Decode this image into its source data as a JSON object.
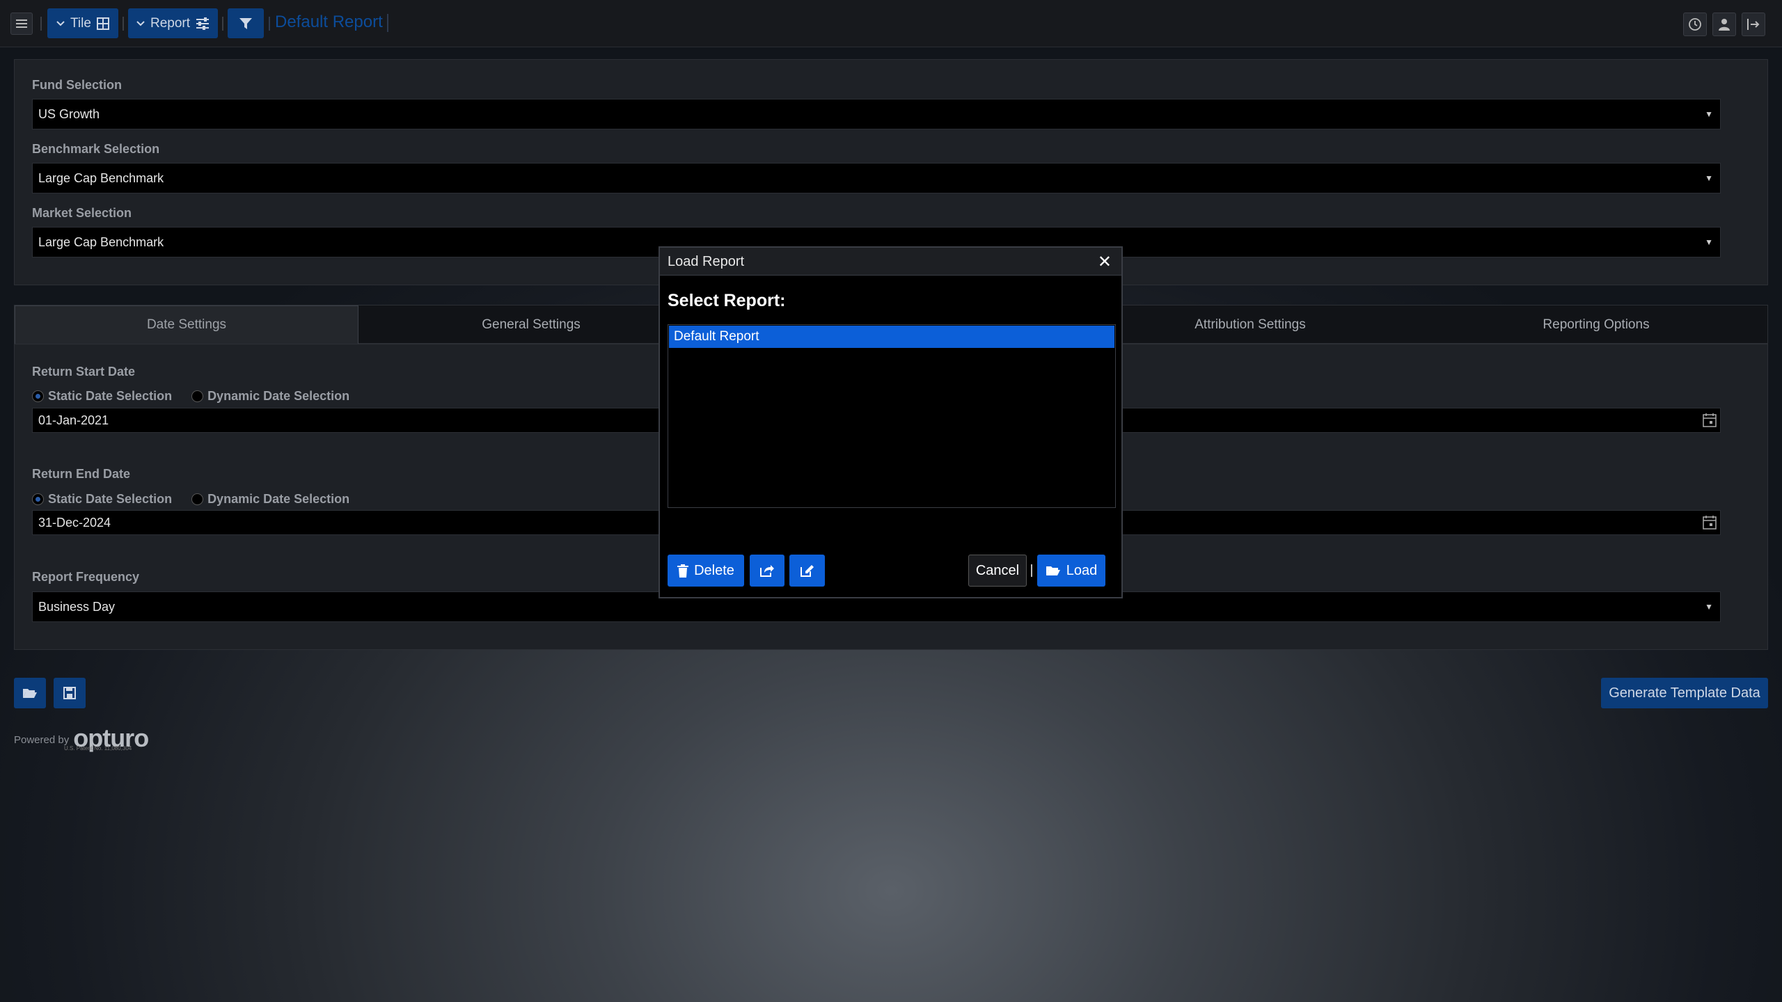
{
  "topbar": {
    "tile_label": "Tile",
    "report_label": "Report",
    "title": "Default Report"
  },
  "selections": {
    "fund_label": "Fund Selection",
    "fund_value": "US Growth",
    "benchmark_label": "Benchmark Selection",
    "benchmark_value": "Large Cap Benchmark",
    "market_label": "Market Selection",
    "market_value": "Large Cap Benchmark"
  },
  "tabs": [
    {
      "label": "Date Settings",
      "active": true
    },
    {
      "label": "General Settings",
      "active": false
    },
    {
      "label": "Attribution Settings",
      "active": false
    },
    {
      "label": "Reporting Options",
      "active": false
    }
  ],
  "dates": {
    "start_label": "Return Start Date",
    "static_label": "Static Date Selection",
    "dynamic_label": "Dynamic Date Selection",
    "start_value": "01-Jan-2021",
    "end_label": "Return End Date",
    "end_value": "31-Dec-2024",
    "frequency_label": "Report Frequency",
    "frequency_value": "Business Day"
  },
  "footer": {
    "generate_label": "Generate Template Data",
    "powered_by": "Powered by",
    "brand": "opturo",
    "patent": "U.S. Patent No. 11,080,304"
  },
  "modal": {
    "title": "Load Report",
    "close": "✕",
    "heading": "Select Report:",
    "items": [
      "Default Report"
    ],
    "delete_label": "Delete",
    "cancel_label": "Cancel",
    "load_label": "Load"
  },
  "colors": {
    "accent": "#0c5fd8",
    "button_dark_blue": "#0b3c7a"
  }
}
